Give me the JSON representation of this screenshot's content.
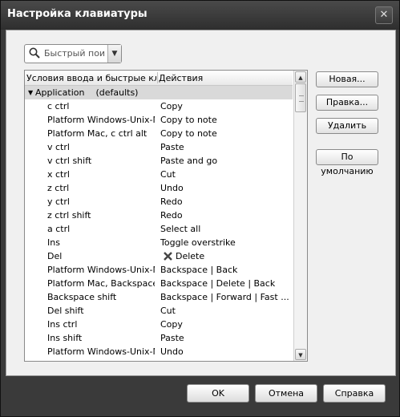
{
  "window": {
    "title": "Настройка клавиатуры",
    "close_glyph": "✕"
  },
  "search": {
    "placeholder": "Быстрый поиск",
    "dropdown_glyph": "▼",
    "icon": "search-icon"
  },
  "list": {
    "columns": [
      "Условия ввода и быстрые клавиши",
      "Действия"
    ],
    "column_display": [
      "Условия ввода и быстрые кл...",
      "Действия"
    ],
    "group": {
      "expander": "▼",
      "label": "Application    (defaults)"
    },
    "rows": [
      {
        "key": "c ctrl",
        "action": "Copy"
      },
      {
        "key": "Platform Windows-Unix-M...",
        "action": "Copy to note"
      },
      {
        "key": "Platform Mac, c ctrl alt",
        "action": "Copy to note"
      },
      {
        "key": "v ctrl",
        "action": "Paste"
      },
      {
        "key": "v ctrl shift",
        "action": "Paste and go"
      },
      {
        "key": "x ctrl",
        "action": "Cut"
      },
      {
        "key": "z ctrl",
        "action": "Undo"
      },
      {
        "key": "y ctrl",
        "action": "Redo"
      },
      {
        "key": "z ctrl shift",
        "action": "Redo"
      },
      {
        "key": "a ctrl",
        "action": "Select all"
      },
      {
        "key": "Ins",
        "action": "Toggle overstrike"
      },
      {
        "key": "Del",
        "action": "Delete",
        "icon": "delete-x-icon"
      },
      {
        "key": "Platform Windows-Unix-M...",
        "action": "Backspace | Back"
      },
      {
        "key": "Platform Mac, Backspace",
        "action": "Backspace | Delete | Back"
      },
      {
        "key": "Backspace shift",
        "action": "Backspace | Forward | Fast ..."
      },
      {
        "key": "Del shift",
        "action": "Cut"
      },
      {
        "key": "Ins ctrl",
        "action": "Copy"
      },
      {
        "key": "Ins shift",
        "action": "Paste"
      },
      {
        "key": "Platform Windows-Unix-M...",
        "action": "Undo"
      }
    ]
  },
  "side_buttons": {
    "new": "Новая...",
    "edit": "Правка...",
    "delete": "Удалить",
    "defaults": "По умолчанию"
  },
  "footer": {
    "ok": "OK",
    "cancel": "Отмена",
    "help": "Справка"
  },
  "scrollbar": {
    "up": "▲",
    "down": "▼"
  }
}
